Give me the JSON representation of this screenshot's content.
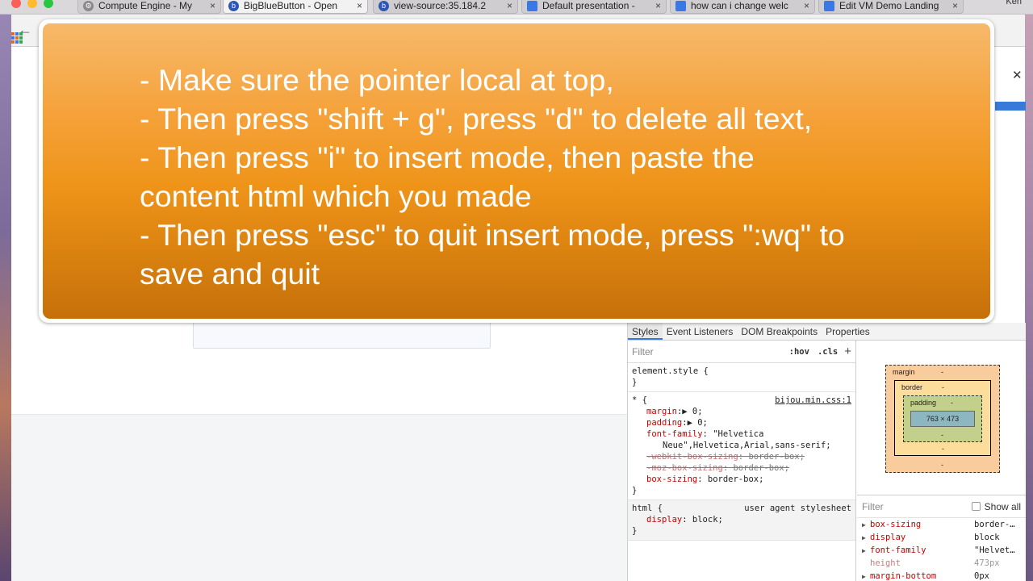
{
  "browser": {
    "tabs": [
      {
        "title": "Compute Engine - My",
        "favicon": "gear-icon",
        "close": "×"
      },
      {
        "title": "BigBlueButton - Open",
        "favicon": "bigbluebutton-icon",
        "close": "×"
      },
      {
        "title": "view-source:35.184.2",
        "favicon": "bigbluebutton-icon",
        "close": "×"
      },
      {
        "title": "Default presentation -",
        "favicon": "document-icon",
        "close": "×"
      },
      {
        "title": "how can i change welc",
        "favicon": "document-icon",
        "close": "×"
      },
      {
        "title": "Edit VM Demo Landing",
        "favicon": "document-icon",
        "close": "×"
      }
    ],
    "profile_name": "Ken",
    "back_glyph": "←"
  },
  "instruction": {
    "lines": [
      "- Make sure the pointer local at top,",
      "- Then press \"shift + g\", press \"d\" to delete all text,",
      "- Then press \"i\" to insert mode, then paste the",
      "content html which you made",
      "- Then press \"esc\" to quit insert mode, press \":wq\" to",
      "save and quit"
    ]
  },
  "devtools": {
    "close_glyph": "✕",
    "tabs": [
      "Styles",
      "Event Listeners",
      "DOM Breakpoints",
      "Properties"
    ],
    "active_tab": "Styles",
    "styles": {
      "filter_placeholder": "Filter",
      "hov": ":hov",
      "cls": ".cls",
      "add": "+",
      "element_style": "element.style {",
      "close_brace": "}",
      "universal_rule": {
        "selector": "* {",
        "source": "bijou.min.css:1",
        "decls": [
          {
            "prop": "margin",
            "sep": ":",
            "val": "▶ 0;"
          },
          {
            "prop": "padding",
            "sep": ":",
            "val": "▶ 0;"
          },
          {
            "prop": "font-family",
            "sep": ":",
            "val": " \"Helvetica"
          },
          {
            "prop": "",
            "sep": "",
            "val": "Neue\",Helvetica,Arial,sans-serif;"
          },
          {
            "prop": "-webkit-box-sizing",
            "sep": ":",
            "val": " border-box;"
          },
          {
            "prop": "-moz-box-sizing",
            "sep": ":",
            "val": " border-box;"
          },
          {
            "prop": "box-sizing",
            "sep": ":",
            "val": " border-box;"
          }
        ]
      },
      "html_rule": {
        "selector": "html {",
        "source": "user agent stylesheet",
        "decls": [
          {
            "prop": "display",
            "sep": ":",
            "val": " block;"
          }
        ]
      }
    },
    "box_model": {
      "margin_label": "margin",
      "border_label": "border",
      "padding_label": "padding",
      "content_size": "763 × 473",
      "dash": "-"
    },
    "computed": {
      "filter_placeholder": "Filter",
      "show_all_label": "Show all",
      "rows": [
        {
          "name": "box-sizing",
          "value": "border-…"
        },
        {
          "name": "display",
          "value": "block"
        },
        {
          "name": "font-family",
          "value": "\"Helvet…"
        },
        {
          "name": "height",
          "value": "473px"
        },
        {
          "name": "margin-bottom",
          "value": "0px"
        }
      ]
    }
  }
}
